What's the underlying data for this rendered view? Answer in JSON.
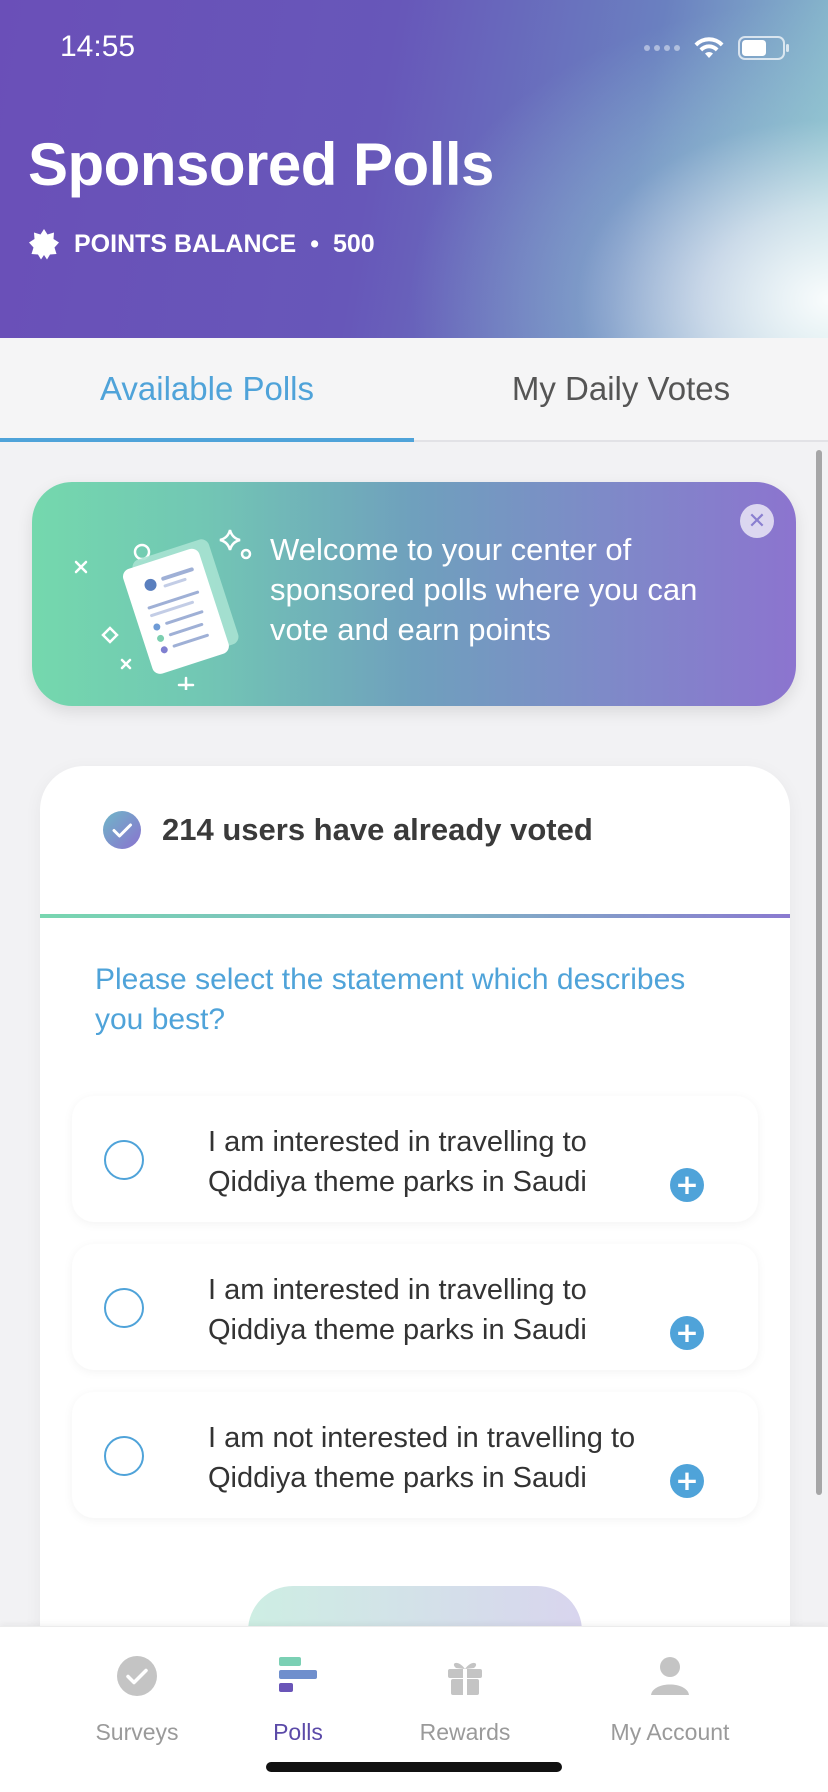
{
  "status_bar": {
    "time": "14:55"
  },
  "header": {
    "title": "Sponsored Polls",
    "points_label": "POINTS BALANCE",
    "separator": "•",
    "points_value": "500"
  },
  "tabs": [
    {
      "label": "Available Polls",
      "active": true
    },
    {
      "label": "My Daily Votes",
      "active": false
    }
  ],
  "banner": {
    "text": "Welcome to your center of sponsored polls where you can vote and earn points",
    "close_icon": "close-icon"
  },
  "poll": {
    "voted_text": "214 users have already voted",
    "question": "Please select the statement which describes you best?",
    "options": [
      {
        "text": "I am interested in travelling to Qiddiya theme parks in Saudi Arabia"
      },
      {
        "text": "I am interested in travelling to Qiddiya theme parks in Saudi Arabia"
      },
      {
        "text": "I am not interested in travelling to Qiddiya theme parks in Saudi Arabia"
      }
    ]
  },
  "bottom_nav": [
    {
      "label": "Surveys",
      "icon": "check-circle-icon",
      "active": false
    },
    {
      "label": "Polls",
      "icon": "polls-icon",
      "active": true
    },
    {
      "label": "Rewards",
      "icon": "gift-icon",
      "active": false
    },
    {
      "label": "My Account",
      "icon": "user-icon",
      "active": false
    }
  ],
  "colors": {
    "accent_blue": "#4fa3d9",
    "header_purple": "#6a4fb8",
    "active_nav": "#5b4aa8"
  }
}
